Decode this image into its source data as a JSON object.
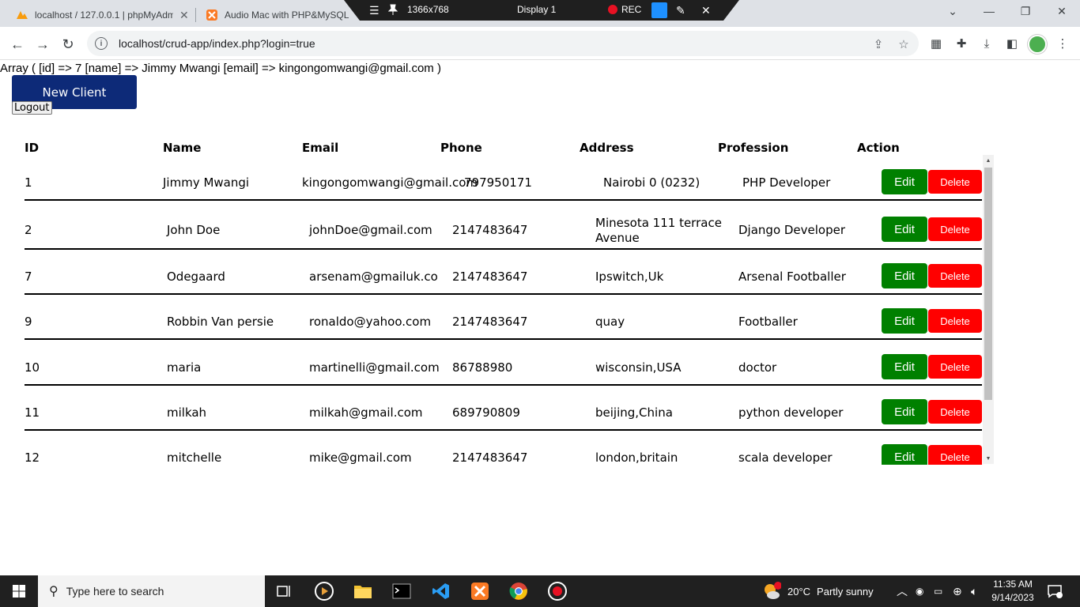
{
  "browser": {
    "tabs": [
      {
        "title": "localhost / 127.0.0.1 | phpMyAdmin",
        "active": false
      },
      {
        "title": "Audio Mac with PHP&MySQL",
        "active": false
      }
    ],
    "recorder": {
      "resolution": "1366x768",
      "display": "Display 1",
      "rec_label": "REC"
    },
    "url": "localhost/crud-app/index.php?login=true"
  },
  "page": {
    "dump_text": "Array ( [id] => 7 [name] => Jimmy Mwangi [email] => kingongomwangi@gmail.com )",
    "new_client_label": "New Client",
    "logout_label": "Logout",
    "headers": {
      "id": "ID",
      "name": "Name",
      "email": "Email",
      "phone": "Phone",
      "address": "Address",
      "profession": "Profession",
      "action": "Action"
    },
    "edit_label": "Edit",
    "delete_label": "Delete",
    "rows": [
      {
        "id": "1",
        "name": "Jimmy Mwangi",
        "email": "kingongomwangi@gmail.com",
        "phone": "797950171",
        "address": "Nairobi 0 (0232)",
        "profession": "PHP Developer"
      },
      {
        "id": "2",
        "name": "John Doe",
        "email": "johnDoe@gmail.com",
        "phone": "2147483647",
        "address": "Minesota 111 terrace Avenue",
        "profession": "Django Developer"
      },
      {
        "id": "7",
        "name": "Odegaard",
        "email": "arsenam@gmailuk.co",
        "phone": "2147483647",
        "address": "Ipswitch,Uk",
        "profession": "Arsenal Footballer"
      },
      {
        "id": "9",
        "name": "Robbin Van persie",
        "email": "ronaldo@yahoo.com",
        "phone": "2147483647",
        "address": "quay",
        "profession": "Footballer"
      },
      {
        "id": "10",
        "name": "maria",
        "email": "martinelli@gmail.com",
        "phone": "86788980",
        "address": "wisconsin,USA",
        "profession": "doctor"
      },
      {
        "id": "11",
        "name": "milkah",
        "email": "milkah@gmail.com",
        "phone": "689790809",
        "address": "beijing,China",
        "profession": "python developer"
      },
      {
        "id": "12",
        "name": "mitchelle",
        "email": "mike@gmail.com",
        "phone": "2147483647",
        "address": "london,britain",
        "profession": "scala developer"
      }
    ]
  },
  "taskbar": {
    "search_placeholder": "Type here to search",
    "weather": {
      "temp": "20°C",
      "condition": "Partly sunny"
    },
    "time": "11:35 AM",
    "date": "9/14/2023"
  }
}
